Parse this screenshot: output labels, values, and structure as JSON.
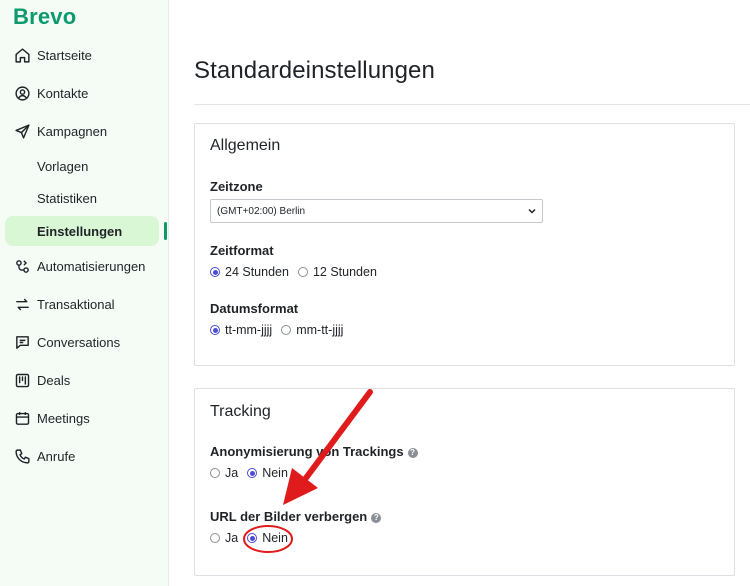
{
  "app": {
    "logo": "Brevo"
  },
  "sidebar": {
    "items": [
      {
        "label": "Startseite",
        "icon": "home-icon"
      },
      {
        "label": "Kontakte",
        "icon": "contact-icon"
      },
      {
        "label": "Kampagnen",
        "icon": "send-icon"
      },
      {
        "label": "Automatisierungen",
        "icon": "automation-icon"
      },
      {
        "label": "Transaktional",
        "icon": "transfer-icon"
      },
      {
        "label": "Conversations",
        "icon": "chat-icon"
      },
      {
        "label": "Deals",
        "icon": "deals-icon"
      },
      {
        "label": "Meetings",
        "icon": "calendar-icon"
      },
      {
        "label": "Anrufe",
        "icon": "phone-icon"
      }
    ],
    "subitems": [
      {
        "label": "Vorlagen"
      },
      {
        "label": "Statistiken"
      },
      {
        "label": "Einstellungen",
        "active": true
      }
    ]
  },
  "main": {
    "title": "Standardeinstellungen",
    "allgemein": {
      "title": "Allgemein",
      "zeitzone": {
        "label": "Zeitzone",
        "value": "(GMT+02:00) Berlin"
      },
      "zeitformat": {
        "label": "Zeitformat",
        "options": [
          "24 Stunden",
          "12 Stunden"
        ],
        "selected": "24 Stunden"
      },
      "datumsformat": {
        "label": "Datumsformat",
        "options": [
          "tt-mm-jjjj",
          "mm-tt-jjjj"
        ],
        "selected": "tt-mm-jjjj"
      }
    },
    "tracking": {
      "title": "Tracking",
      "anonymisierung": {
        "label": "Anonymisierung von Trackings",
        "options": [
          "Ja",
          "Nein"
        ],
        "selected": "Nein"
      },
      "url_bilder": {
        "label": "URL der Bilder verbergen",
        "options": [
          "Ja",
          "Nein"
        ],
        "selected": "Nein"
      }
    }
  },
  "colors": {
    "brand": "#0b996e",
    "active_bg": "#d9f7d4",
    "radio": "#4b4bd6",
    "annotation": "#e01b1b"
  }
}
